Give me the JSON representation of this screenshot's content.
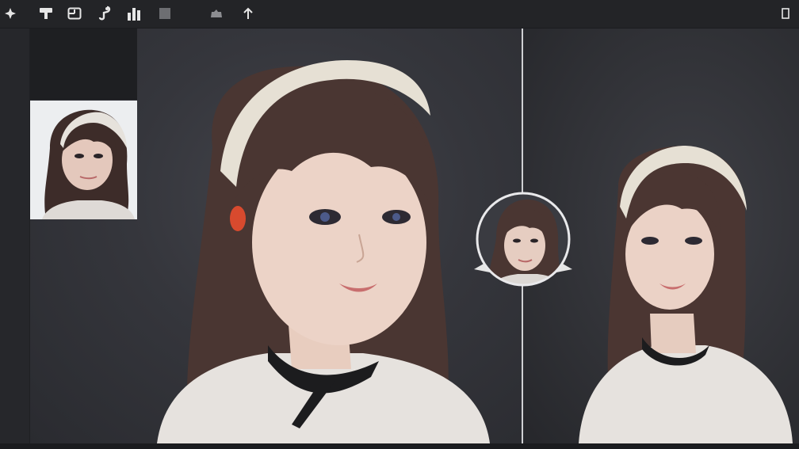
{
  "toolbar": {
    "items": [
      {
        "icon": "compass-star-icon"
      },
      {
        "icon": "stamp-tool-icon"
      },
      {
        "icon": "crop-frame-icon"
      },
      {
        "icon": "brush-hook-icon"
      },
      {
        "icon": "bar-graph-icon"
      },
      {
        "icon": "square-stop-icon"
      },
      {
        "icon": "cloud-upload-icon"
      },
      {
        "icon": "arrow-up-icon"
      },
      {
        "icon": "panel-toggle-icon"
      }
    ]
  },
  "colors": {
    "toolbar_bg": "#232427",
    "canvas_bg": "#35363c",
    "divider": "#cfd0d3",
    "icon": "#e6e6e6"
  }
}
